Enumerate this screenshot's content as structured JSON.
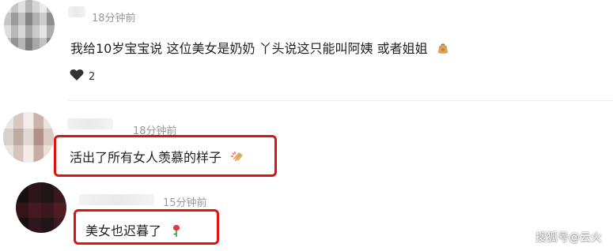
{
  "comments": [
    {
      "time": "18分钟前",
      "text": "我给10岁宝宝说 这位美女是奶奶 丫头说这只能叫阿姨 或者姐姐",
      "emoji": "bag-icon",
      "likes": "2"
    },
    {
      "time": "18分钟前",
      "text": "活出了所有女人羡慕的样子",
      "emoji": "clap-icon",
      "highlight_color": "#e01212"
    },
    {
      "time": "15分钟前",
      "text": "美女也迟暮了",
      "emoji": "rose-icon",
      "highlight_color": "#e01212"
    }
  ],
  "watermark": "搜狐号@云火"
}
